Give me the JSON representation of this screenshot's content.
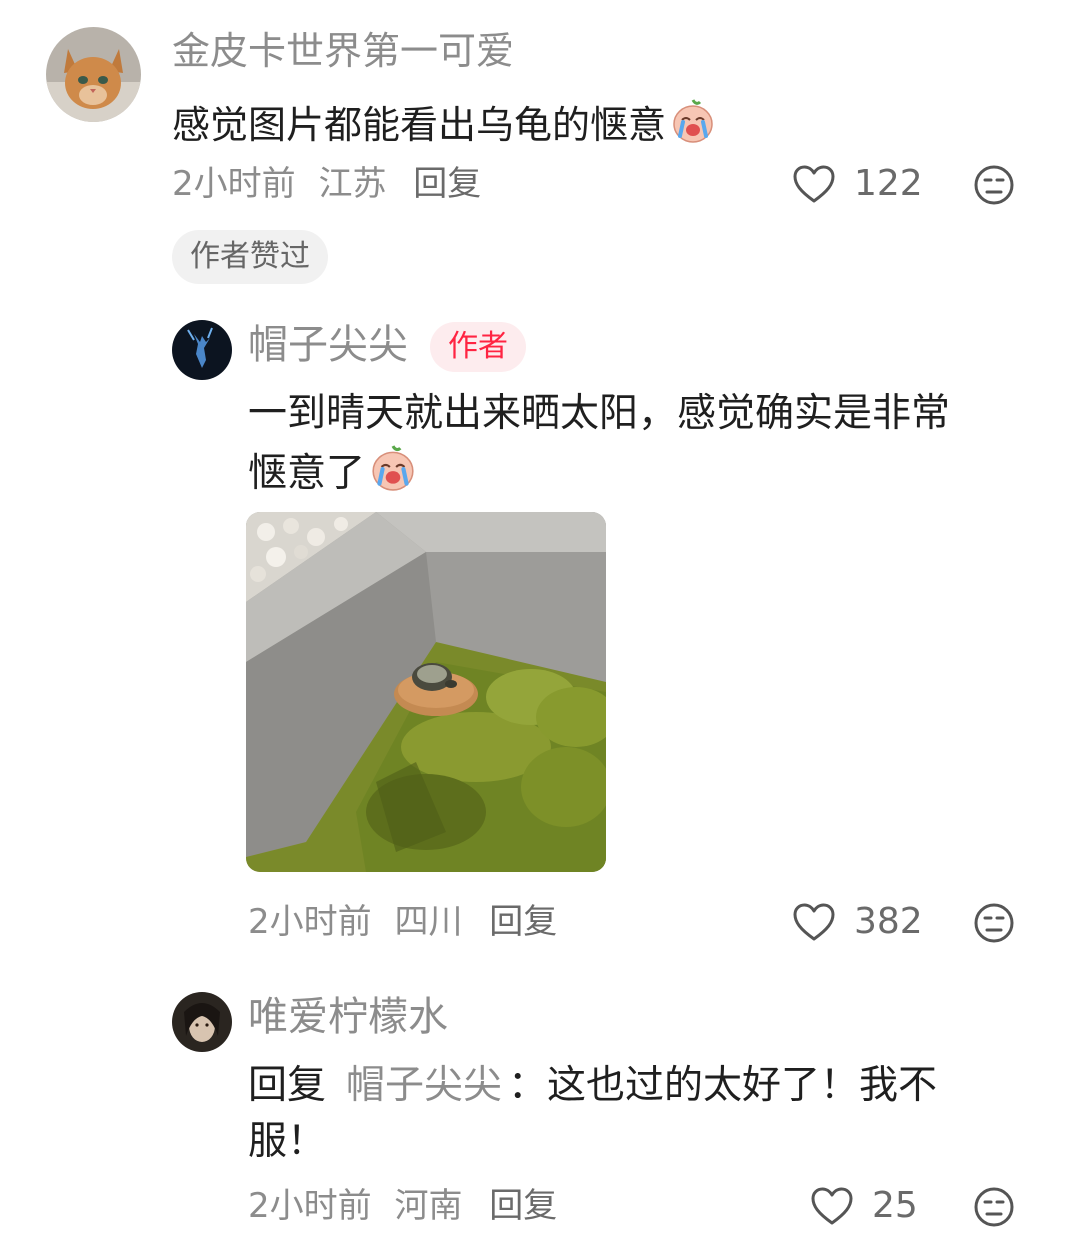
{
  "comments": [
    {
      "username": "金皮卡世界第一可爱",
      "text": "感觉图片都能看出乌龟的惬意",
      "emoji": "crying-laughing-emoji",
      "time": "2小时前",
      "location": "江苏",
      "reply_label": "回复",
      "likes": "122",
      "badge": "作者赞过"
    }
  ],
  "replies": [
    {
      "username": "帽子尖尖",
      "author_badge": "作者",
      "text_line1": "一到晴天就出来晒太阳，感觉确实是非常",
      "text_line2": "惬意了",
      "emoji": "crying-laughing-emoji",
      "image": "turtle-on-rock-in-pond",
      "time": "2小时前",
      "location": "四川",
      "reply_label": "回复",
      "likes": "382"
    },
    {
      "username": "唯爱柠檬水",
      "reply_prefix": "回复",
      "mention": "帽子尖尖",
      "text_line1": "：这也过的太好了！我不",
      "text_line2": "服！",
      "time": "2小时前",
      "location": "河南",
      "reply_label": "回复",
      "likes": "25"
    }
  ],
  "icons": {
    "like": "heart-outline-icon",
    "dislike": "neutral-face-icon"
  },
  "colors": {
    "author_badge_text": "#ff2442",
    "author_badge_bg": "#fdecee",
    "secondary_text": "#8c8c8c",
    "primary_text": "#1f1f1f"
  }
}
